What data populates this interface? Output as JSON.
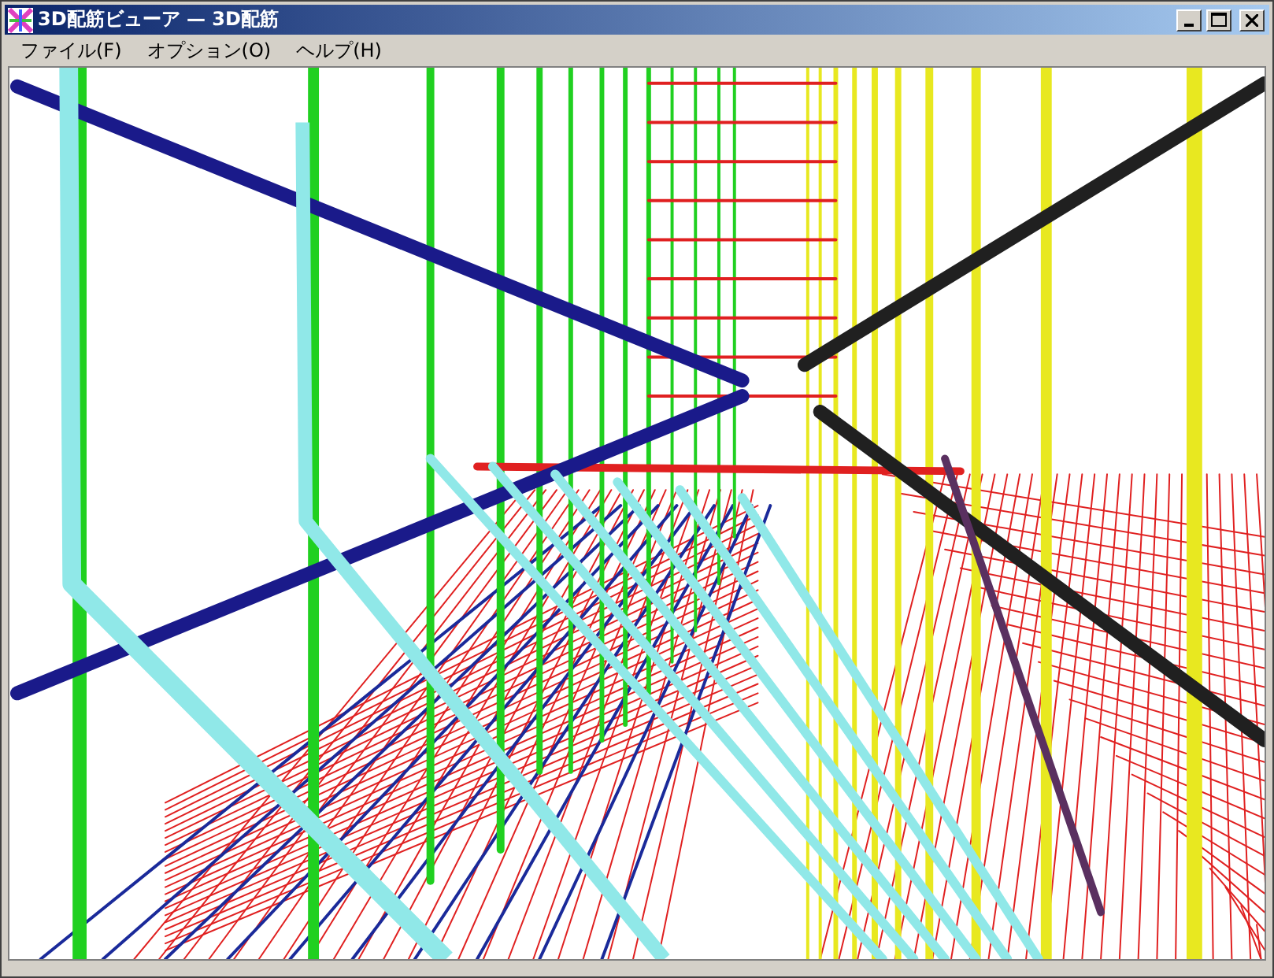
{
  "window": {
    "title": "3D配筋ビューア — 3D配筋"
  },
  "menu": [
    {
      "label": "ファイル(F)"
    },
    {
      "label": "オプション(O)"
    },
    {
      "label": "ヘルプ(H)"
    }
  ]
}
